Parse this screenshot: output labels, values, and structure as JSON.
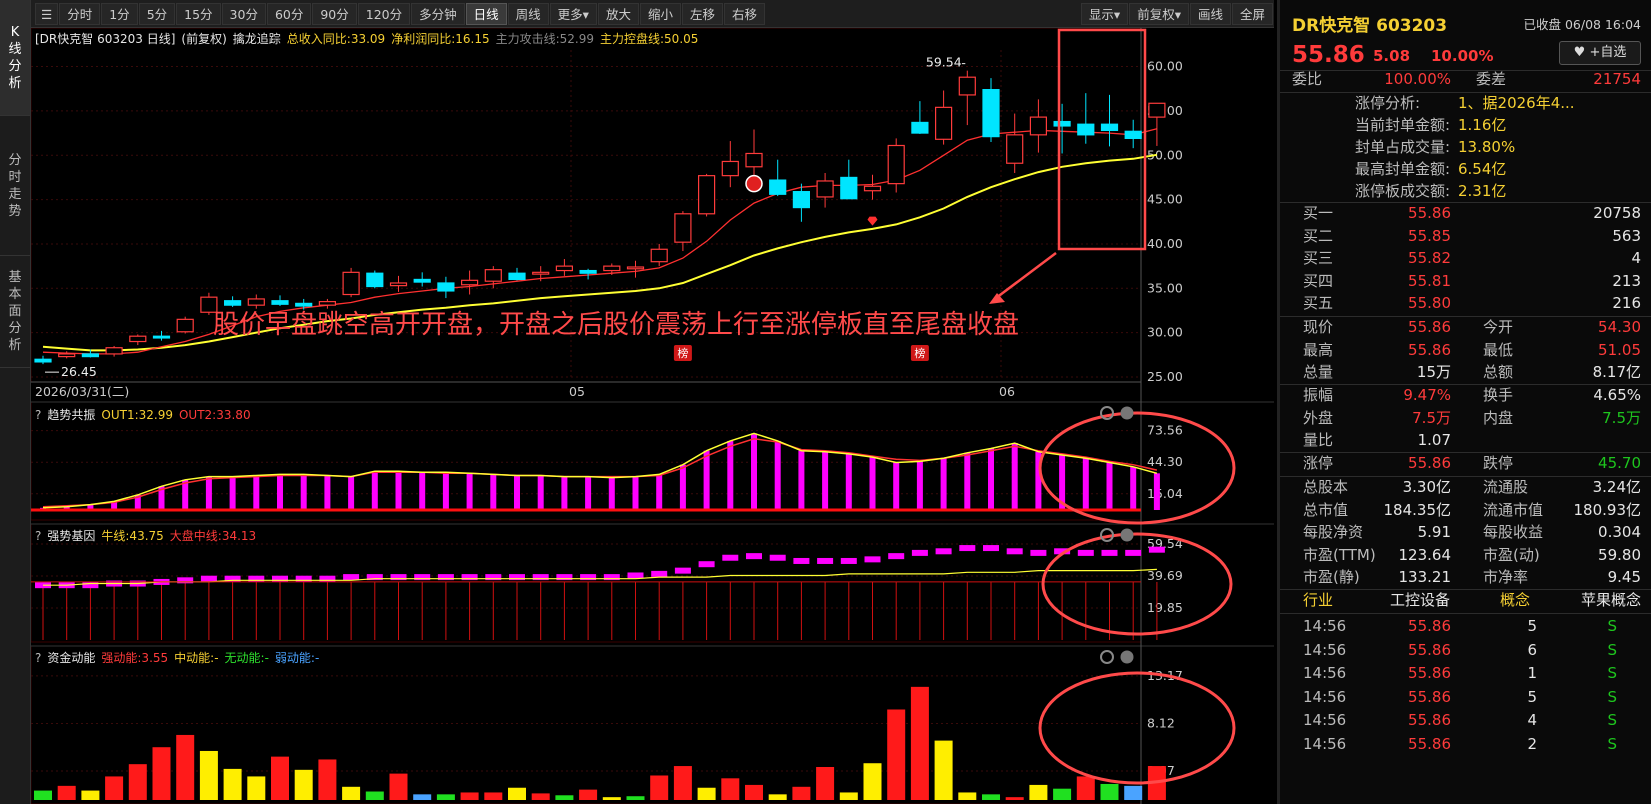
{
  "nav": {
    "kline": "K线分析",
    "fenshi": "分时走势",
    "jiben": "基本面分析"
  },
  "toolbar": {
    "periods": [
      "分时",
      "1分",
      "5分",
      "15分",
      "30分",
      "60分",
      "90分",
      "120分",
      "多分钟",
      "日线",
      "周线",
      "更多▾",
      "放大",
      "缩小",
      "左移",
      "右移"
    ],
    "active": "日线",
    "right": [
      "显示▾",
      "前复权▾",
      "画线",
      "全屏"
    ]
  },
  "header": {
    "stock": "[DR快克智 603203 日线]",
    "adj": "(前复权)",
    "indicator": "擒龙追踪",
    "inc": "总收入同比:33.09",
    "profit": "净利润同比:16.15",
    "attack": "主力攻击线:52.99",
    "control": "主力控盘线:50.05"
  },
  "main": {
    "y_ticks": [
      "60.00",
      "55.00",
      "50.00",
      "45.00",
      "40.00",
      "35.00",
      "30.00",
      "25.00"
    ],
    "high_label": "59.54",
    "low_label": "26.45",
    "date_label": "2026/03/31(二)",
    "month_labels": [
      "05",
      "06"
    ],
    "rank_label": "榜",
    "annotation": "股价早盘跳空高开开盘，开盘之后股价震荡上行至涨停板直至尾盘收盘"
  },
  "ind1": {
    "name": "趋势共振",
    "out1": "OUT1:32.99",
    "out2": "OUT2:33.80",
    "y_ticks": [
      "73.56",
      "44.30",
      "15.04"
    ]
  },
  "ind2": {
    "name": "强势基因",
    "bull": "牛线:43.75",
    "mid": "大盘中线:34.13",
    "y_ticks": [
      "59.54",
      "39.69",
      "19.85"
    ]
  },
  "ind3": {
    "name": "资金动能",
    "strong": "强动能:3.55",
    "medium": "中动能:-",
    "none": "无动能:-",
    "weak": "弱动能:-",
    "y_ticks": [
      "13.17",
      "8.12",
      "3.07"
    ]
  },
  "colors": {
    "up": "#ff3b3b",
    "down": "#00e5ff",
    "ma_red": "#ff3030",
    "ma_yellow": "#ffff33",
    "magenta": "#ff00ff",
    "annot": "#ff4a4a"
  },
  "chart_data": [
    {
      "type": "candlestick",
      "name": "日线",
      "dates_first": "2026/03/31",
      "ylim": [
        25,
        62
      ],
      "ohlc": [
        [
          27,
          27.4,
          26.45,
          26.7
        ],
        [
          27.3,
          27.9,
          27.1,
          27.6
        ],
        [
          27.6,
          28.1,
          27.2,
          27.3
        ],
        [
          27.6,
          28.5,
          27.3,
          28.3
        ],
        [
          29,
          29.8,
          28.6,
          29.6
        ],
        [
          29.6,
          30.2,
          29.1,
          29.4
        ],
        [
          30.1,
          31.8,
          29.9,
          31.5
        ],
        [
          32.3,
          34.5,
          32,
          34
        ],
        [
          33.6,
          34.1,
          32.9,
          33.1
        ],
        [
          33.1,
          34.3,
          32.7,
          33.8
        ],
        [
          33.6,
          34.2,
          33,
          33.2
        ],
        [
          33.3,
          33.8,
          32.6,
          33
        ],
        [
          33.1,
          33.8,
          32.7,
          33.5
        ],
        [
          34.3,
          37.3,
          34,
          36.8
        ],
        [
          36.7,
          37,
          35,
          35.2
        ],
        [
          35.3,
          36.4,
          34.6,
          35.6
        ],
        [
          36,
          36.8,
          35.2,
          35.7
        ],
        [
          35.6,
          36.3,
          33.9,
          34.7
        ],
        [
          35.4,
          37,
          34.3,
          35.9
        ],
        [
          35.8,
          37.5,
          35,
          37.1
        ],
        [
          36.7,
          37.3,
          35.9,
          36
        ],
        [
          36.6,
          37.5,
          35.8,
          36.8
        ],
        [
          37,
          38.3,
          36.4,
          37.5
        ],
        [
          37,
          37.2,
          36,
          36.7
        ],
        [
          37,
          37.8,
          36.5,
          37.5
        ],
        [
          37.2,
          38.1,
          36.2,
          37.4
        ],
        [
          38,
          40,
          37.5,
          39.4
        ],
        [
          40.2,
          43.7,
          39.2,
          43.4
        ],
        [
          43.4,
          47.9,
          43.1,
          47.7
        ],
        [
          47.7,
          51.6,
          46.4,
          49.3
        ],
        [
          48.7,
          52.9,
          47.7,
          50.2
        ],
        [
          47.2,
          49.5,
          45.4,
          45.6
        ],
        [
          45.9,
          46.8,
          42.5,
          44.1
        ],
        [
          45.3,
          48,
          44.1,
          47.1
        ],
        [
          47.5,
          49.5,
          45.1,
          45.1
        ],
        [
          46,
          47.8,
          45,
          46.5
        ],
        [
          46.8,
          51.9,
          45.8,
          51.1
        ],
        [
          53.7,
          56.1,
          52.4,
          52.5
        ],
        [
          51.8,
          57.3,
          51.2,
          55.4
        ],
        [
          56.8,
          59.54,
          53.4,
          58.8
        ],
        [
          57.4,
          58.7,
          51.5,
          52.1
        ],
        [
          49.1,
          54.7,
          48,
          52.3
        ],
        [
          52.3,
          56.3,
          50.3,
          54.3
        ],
        [
          53.8,
          55.8,
          50.2,
          53.3
        ],
        [
          53.5,
          57,
          51.3,
          52.3
        ],
        [
          53.5,
          56.8,
          51,
          52.8
        ],
        [
          52.7,
          54,
          50.8,
          51.9
        ],
        [
          54.3,
          55.86,
          51.05,
          55.86
        ]
      ],
      "ma_attack": [
        27.8,
        27.7,
        27.6,
        27.6,
        27.8,
        28.4,
        29,
        29.8,
        30.8,
        31.8,
        32.4,
        32.8,
        33.1,
        33.4,
        34,
        34.4,
        34.7,
        35,
        35.2,
        35.5,
        35.8,
        36.1,
        36.3,
        36.5,
        36.7,
        36.9,
        37.3,
        38.4,
        40.3,
        42.7,
        44.6,
        45.7,
        46.4,
        46.6,
        46.6,
        46.7,
        47.2,
        48.3,
        50,
        51.7,
        52.4,
        52.6,
        52.8,
        52.7,
        52.6,
        52.5,
        52.3,
        52.99
      ],
      "ma_control": [
        28.4,
        28.2,
        28,
        28,
        28.1,
        28.3,
        28.6,
        29,
        29.5,
        30,
        30.5,
        30.9,
        31.3,
        31.6,
        32,
        32.3,
        32.6,
        32.8,
        33.1,
        33.3,
        33.6,
        33.9,
        34.1,
        34.3,
        34.5,
        34.7,
        35,
        35.6,
        36.6,
        37.6,
        38.7,
        39.5,
        40.2,
        40.8,
        41.3,
        41.7,
        42.2,
        43,
        44,
        45.3,
        46.4,
        47.3,
        48.1,
        48.7,
        49.1,
        49.4,
        49.6,
        50.05
      ]
    },
    {
      "type": "bar",
      "name": "趋势共振",
      "ylim": [
        0,
        76
      ],
      "series": [
        {
          "name": "OUT1",
          "values": [
            2,
            3,
            5,
            8,
            14,
            22,
            28,
            31,
            31,
            32,
            33,
            33,
            32,
            31,
            36,
            36,
            35,
            35,
            34,
            33,
            32,
            32,
            31,
            31,
            30,
            31,
            33,
            42,
            55,
            64,
            71,
            64,
            55,
            54,
            52,
            49,
            44,
            45,
            48,
            53,
            57,
            62,
            54,
            51,
            48,
            44,
            40,
            34,
            33,
            34
          ]
        },
        {
          "name": "OUT2",
          "values": [
            3,
            4,
            5,
            7,
            12,
            19,
            25,
            29,
            30,
            31,
            32,
            32,
            32,
            31,
            35,
            35,
            35,
            34,
            34,
            33,
            32,
            32,
            31,
            31,
            31,
            31,
            32,
            39,
            50,
            59,
            66,
            63,
            56,
            55,
            53,
            50,
            47,
            46,
            48,
            51,
            55,
            59,
            55,
            52,
            49,
            45,
            42,
            37,
            35,
            34
          ]
        }
      ]
    },
    {
      "type": "bar",
      "name": "强势基因",
      "ylim": [
        0,
        62
      ],
      "series": [
        {
          "name": "K线",
          "values": [
            34,
            34,
            34,
            35,
            35,
            36,
            37,
            38,
            38,
            38,
            38,
            38,
            38,
            39,
            39,
            39,
            39,
            39,
            39,
            39,
            39,
            39,
            39,
            39,
            39,
            40,
            41,
            43,
            47,
            51,
            52,
            51,
            49,
            49,
            49,
            50,
            52,
            54,
            55,
            57,
            57,
            55,
            54,
            55,
            54,
            54,
            54,
            56
          ]
        },
        {
          "name": "牛线",
          "values": [
            34,
            34,
            35,
            35,
            35,
            36,
            36,
            36,
            37,
            37,
            37,
            37,
            37,
            37,
            38,
            38,
            38,
            38,
            38,
            38,
            38,
            38,
            38,
            38,
            38,
            38,
            39,
            39,
            39,
            40,
            40,
            40,
            40,
            40,
            41,
            41,
            41,
            41,
            41,
            42,
            42,
            42,
            43,
            43,
            43,
            43,
            43,
            43.75
          ]
        }
      ]
    },
    {
      "type": "bar",
      "name": "资金动能",
      "ylim": [
        0,
        14
      ],
      "series": [
        {
          "name": "强动能",
          "values": [
            1,
            1.5,
            1,
            2.5,
            3.8,
            5.6,
            6.9,
            5.2,
            3.3,
            2.5,
            4.6,
            3.2,
            4.3,
            1.4,
            0.9,
            2.8,
            0.6,
            0.6,
            0.8,
            0.8,
            1.3,
            0.7,
            0.5,
            1.1,
            0.3,
            0.4,
            2.6,
            3.6,
            1.3,
            2.3,
            1.6,
            0.6,
            1.4,
            3.5,
            0.8,
            3.9,
            9.6,
            12,
            6.3,
            0.8,
            0.6,
            0.3,
            1.6,
            1.2,
            2.5,
            1.7,
            1.5,
            3.6
          ]
        },
        {
          "name": "颜色",
          "values": [
            2,
            1,
            3,
            1,
            1,
            1,
            1,
            3,
            3,
            3,
            1,
            3,
            1,
            3,
            2,
            1,
            4,
            2,
            1,
            1,
            3,
            1,
            2,
            1,
            3,
            2,
            1,
            1,
            3,
            1,
            1,
            3,
            1,
            1,
            3,
            3,
            1,
            1,
            3,
            3,
            2,
            1,
            3,
            2,
            1,
            2,
            4,
            1
          ]
        }
      ]
    }
  ],
  "quote": {
    "title": "DR快克智 603203",
    "status": "已收盘 06/08 16:04",
    "price": "55.86",
    "change": "5.08",
    "pct": "10.00%",
    "fav": "♥ +自选",
    "wb_label": "委比",
    "wb": "100.00%",
    "wc_label": "委差",
    "wc": "21754",
    "zt": [
      [
        "涨停分析:",
        "1、据2026年4..."
      ],
      [
        "当前封单金额:",
        "1.16亿"
      ],
      [
        "封单占成交量:",
        "13.80%"
      ],
      [
        "最高封单金额:",
        "6.54亿"
      ],
      [
        "涨停板成交额:",
        "2.31亿"
      ]
    ],
    "buys": [
      [
        "买一",
        "55.86",
        "20758"
      ],
      [
        "买二",
        "55.85",
        "563"
      ],
      [
        "买三",
        "55.82",
        "4"
      ],
      [
        "买四",
        "55.81",
        "213"
      ],
      [
        "买五",
        "55.80",
        "216"
      ]
    ],
    "stats": [
      [
        "现价",
        "55.86",
        "今开",
        "54.30"
      ],
      [
        "最高",
        "55.86",
        "最低",
        "51.05"
      ],
      [
        "总量",
        "15万",
        "总额",
        "8.17亿"
      ]
    ],
    "stats2": [
      [
        "振幅",
        "9.47%",
        "换手",
        "4.65%"
      ],
      [
        "外盘",
        "7.5万",
        "内盘",
        "7.5万"
      ],
      [
        "量比",
        "1.07",
        "",
        ""
      ]
    ],
    "limit": [
      "涨停",
      "55.86",
      "跌停",
      "45.70"
    ],
    "fund": [
      [
        "总股本",
        "3.30亿",
        "流通股",
        "3.24亿"
      ],
      [
        "总市值",
        "184.35亿",
        "流通市值",
        "180.93亿"
      ],
      [
        "每股净资",
        "5.91",
        "每股收益",
        "0.304"
      ],
      [
        "市盈(TTM)",
        "123.64",
        "市盈(动)",
        "59.80"
      ],
      [
        "市盈(静)",
        "133.21",
        "市净率",
        "9.45"
      ]
    ],
    "industry": [
      "行业",
      "工控设备",
      "概念",
      "苹果概念"
    ],
    "ticks": [
      [
        "14:56",
        "55.86",
        "5",
        "S"
      ],
      [
        "14:56",
        "55.86",
        "6",
        "S"
      ],
      [
        "14:56",
        "55.86",
        "1",
        "S"
      ],
      [
        "14:56",
        "55.86",
        "5",
        "S"
      ],
      [
        "14:56",
        "55.86",
        "4",
        "S"
      ],
      [
        "14:56",
        "55.86",
        "2",
        "S"
      ]
    ]
  }
}
